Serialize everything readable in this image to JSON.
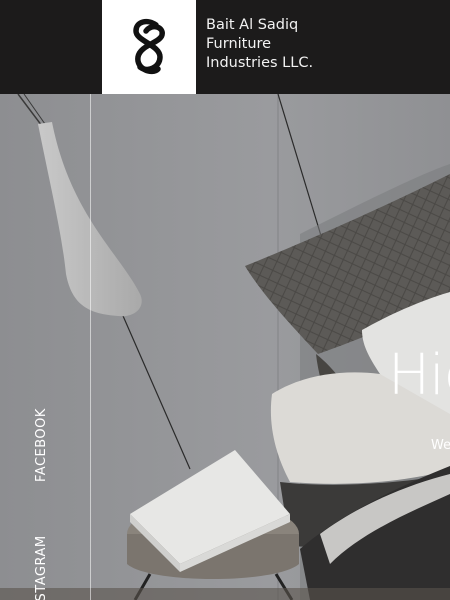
{
  "header": {
    "brand_name": "Bait Al Sadiq\nFurniture\nIndustries LLC.",
    "logo_icon": "s-monogram-logo"
  },
  "hero": {
    "title": "Hig",
    "subtitle": "We"
  },
  "social": {
    "facebook_label": "FACEBOOK",
    "instagram_label": "INSTAGRAM"
  },
  "colors": {
    "header_bg": "#1c1b1b",
    "logo_bg": "#ffffff",
    "hero_overlay": "#8e8f92"
  }
}
